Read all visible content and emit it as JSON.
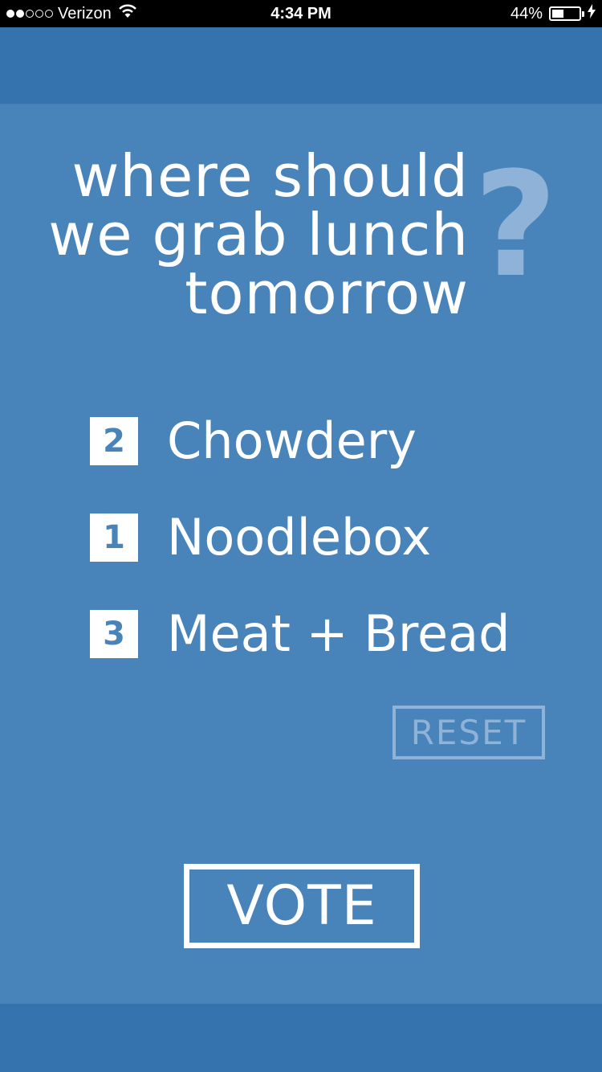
{
  "status_bar": {
    "carrier": "Verizon",
    "signal_bars_filled": 2,
    "signal_bars_total": 5,
    "time": "4:34 PM",
    "battery_percent_label": "44%",
    "battery_level": 0.44
  },
  "question": {
    "lines": [
      "where should",
      "we grab lunch",
      "tomorrow"
    ],
    "mark": "?"
  },
  "options": [
    {
      "votes": "2",
      "label": "Chowdery"
    },
    {
      "votes": "1",
      "label": "Noodlebox"
    },
    {
      "votes": "3",
      "label": "Meat + Bread"
    }
  ],
  "actions": {
    "reset_label": "RESET",
    "vote_label": "VOTE"
  },
  "colors": {
    "background": "#3473ad",
    "card": "#4883b9",
    "accent_light": "#8fb3d8",
    "text": "#ffffff"
  },
  "icons": {
    "wifi": "wifi-icon",
    "battery": "battery-icon",
    "charging": "charging-bolt-icon"
  }
}
